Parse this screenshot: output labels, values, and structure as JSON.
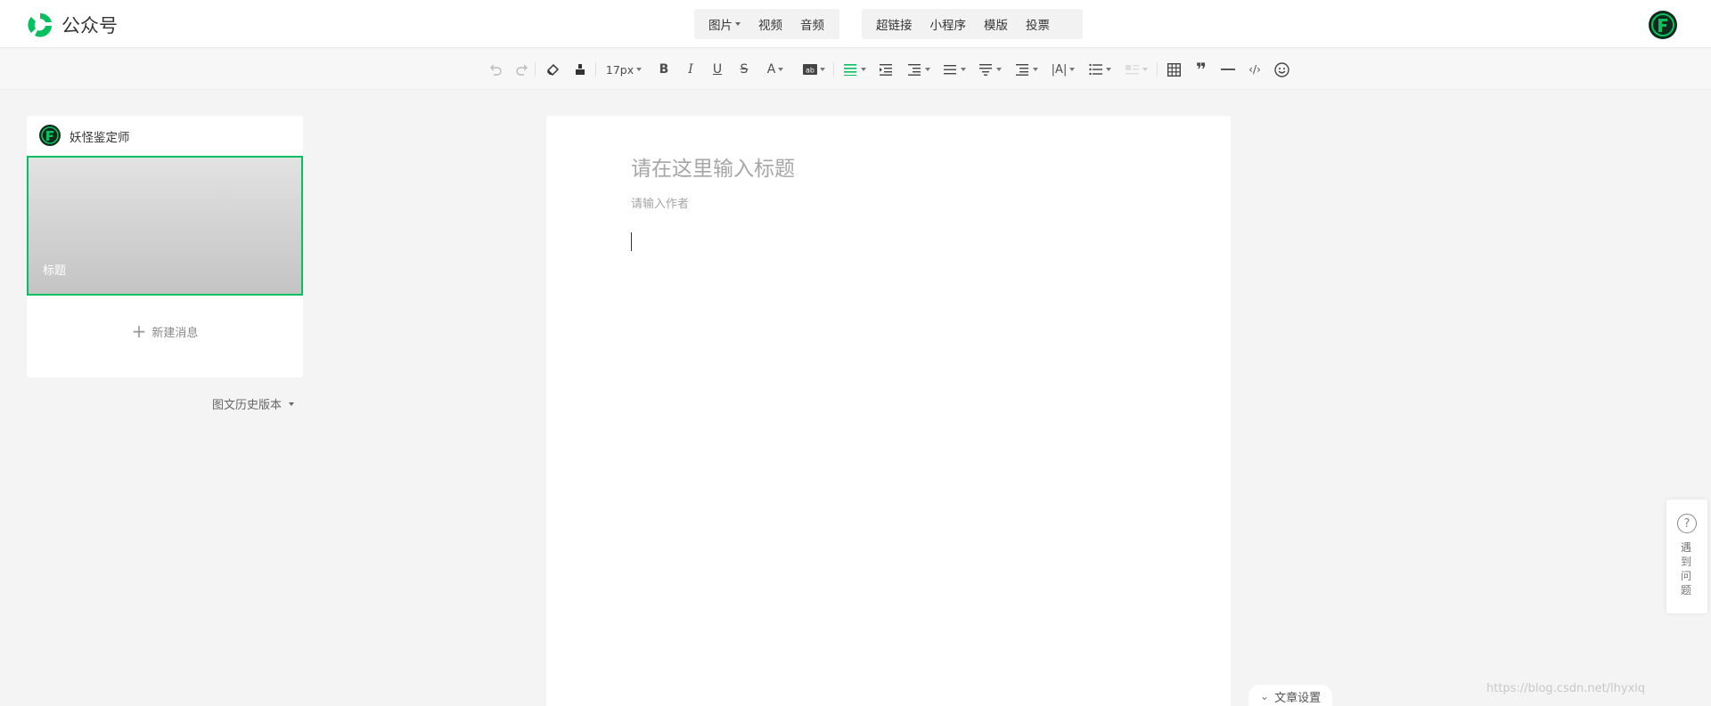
{
  "app": {
    "brand": "公众号"
  },
  "insert_menu": {
    "group1": [
      {
        "label": "图片",
        "has_caret": true
      },
      {
        "label": "视频"
      },
      {
        "label": "音频"
      }
    ],
    "group2": [
      {
        "label": "超链接"
      },
      {
        "label": "小程序"
      },
      {
        "label": "模版"
      },
      {
        "label": "投票"
      }
    ]
  },
  "toolbar": {
    "font_size": "17px",
    "items": [
      "undo-icon",
      "redo-icon",
      "clear-format-icon",
      "format-painter-icon",
      "font-size",
      "bold-icon",
      "italic-icon",
      "underline-icon",
      "strikethrough-icon",
      "font-color-icon",
      "background-color-icon",
      "align-icon",
      "indent-icon",
      "paragraph-indent-icon",
      "line-height-icon",
      "paragraph-spacing-icon",
      "margin-icon",
      "letter-spacing-icon",
      "list-icon",
      "float-icon",
      "table-icon",
      "quote-icon",
      "divider-icon",
      "code-icon",
      "emoji-icon"
    ],
    "accent_color": "#07c160"
  },
  "left_panel": {
    "account_name": "妖怪鉴定师",
    "article_cover_title": "标题",
    "new_message_label": "新建消息",
    "history_label": "图文历史版本"
  },
  "editor": {
    "title_placeholder": "请在这里输入标题",
    "author_placeholder": "请输入作者"
  },
  "help": {
    "label": "遇到问题"
  },
  "footer": {
    "article_settings_label": "文章设置",
    "watermark": "https://blog.csdn.net/lhyxiq"
  },
  "colors": {
    "brand_green": "#07c160",
    "page_bg": "#f4f4f4"
  }
}
